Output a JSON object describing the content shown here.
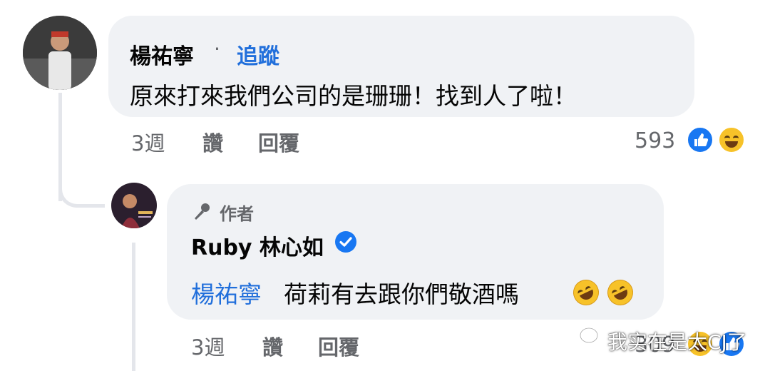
{
  "comment": {
    "author": "楊祐寧",
    "separator": "·",
    "follow_label": "追蹤",
    "text": "原來打來我們公司的是珊珊！找到人了啦！",
    "time": "3週",
    "like_label": "讚",
    "reply_label": "回覆",
    "reaction_count": "593",
    "reaction_icons": [
      "like-icon",
      "haha-icon"
    ]
  },
  "reply": {
    "badge_label": "作者",
    "badge_icon": "microphone-icon",
    "author": "Ruby 林心如",
    "verified_icon": "verified-check-icon",
    "mention": "楊祐寧",
    "text": "荷莉有去跟你們敬酒嗎",
    "emojis": [
      "rolling-on-floor-laughing-emoji",
      "rolling-on-floor-laughing-emoji"
    ],
    "time": "3週",
    "like_label": "讚",
    "reply_label": "回覆",
    "reaction_count": "309",
    "reaction_icons": [
      "haha-icon",
      "like-icon"
    ]
  },
  "watermark": {
    "icon": "wechat-icon",
    "text": "我实在是太CJ了"
  },
  "colors": {
    "bubble": "#f0f2f5",
    "link": "#216fdb",
    "meta": "#65676b",
    "like_blue": "#1877f2",
    "emoji_yellow": "#f7c229"
  }
}
